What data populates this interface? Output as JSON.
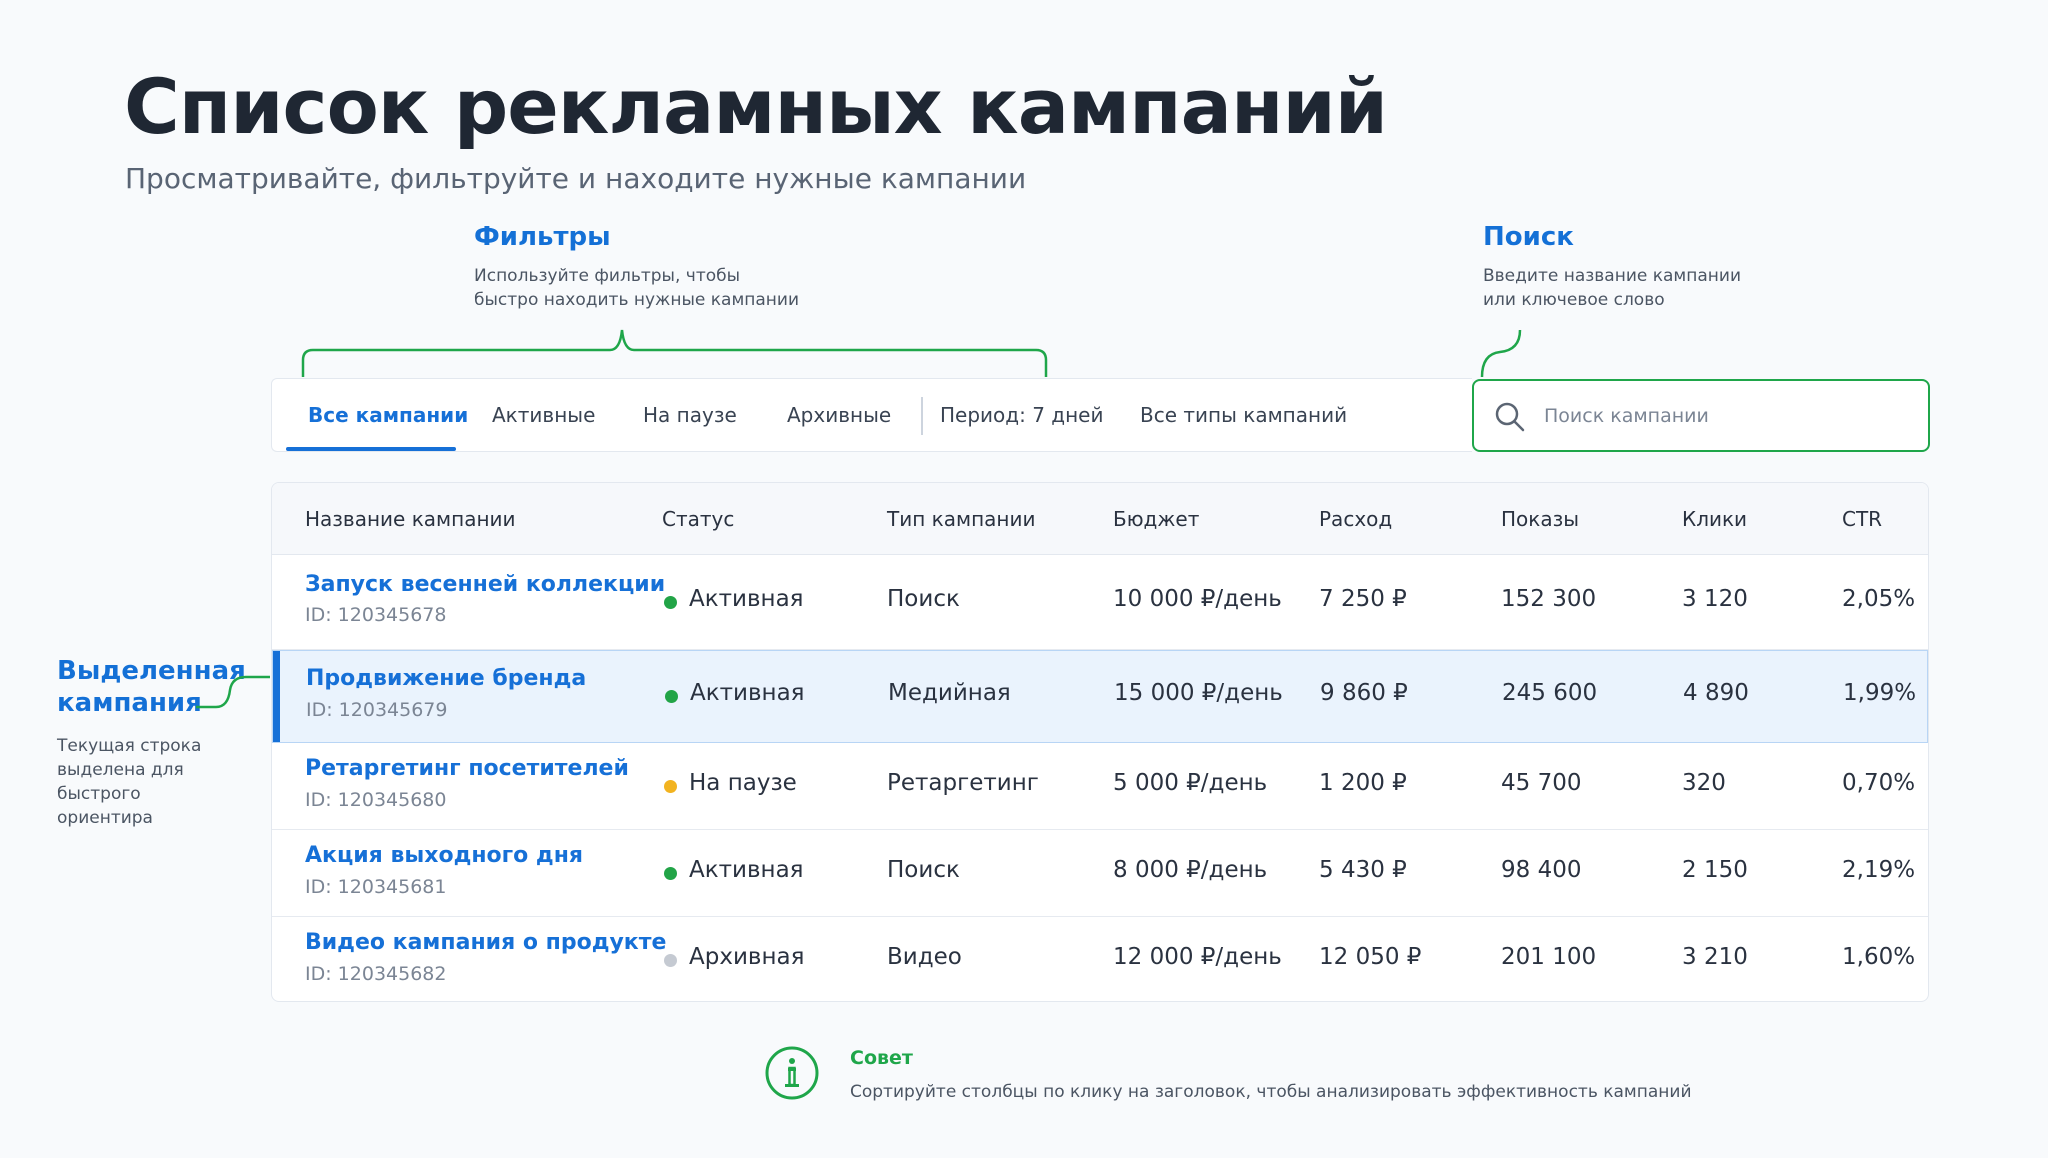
{
  "header": {
    "title": "Список рекламных кампаний",
    "subtitle": "Просматривайте, фильтруйте и находите нужные кампании"
  },
  "annotations": {
    "filters": {
      "title": "Фильтры",
      "line1": "Используйте фильтры, чтобы",
      "line2": "быстро находить нужные кампании"
    },
    "search": {
      "title": "Поиск",
      "line1": "Введите название кампании",
      "line2": "или ключевое слово"
    },
    "selected": {
      "title_line1": "Выделенная",
      "title_line2": "кампания",
      "line1": "Текущая строка",
      "line2": "выделена для",
      "line3": "быстрого",
      "line4": "ориентира"
    }
  },
  "toolbar": {
    "tabs": [
      "Все кампании",
      "Активные",
      "На паузе",
      "Архивные"
    ],
    "active_tab": "Все кампании",
    "period": "Период: 7 дней",
    "type_filter": "Все типы кампаний"
  },
  "search": {
    "placeholder": "Поиск кампании",
    "value": ""
  },
  "table": {
    "headers": [
      "Название кампании",
      "Статус",
      "Тип кампании",
      "Бюджет",
      "Расход",
      "Показы",
      "Клики",
      "CTR"
    ],
    "rows": [
      {
        "name": "Запуск весенней коллекции",
        "id": "ID: 120345678",
        "status": "Активная",
        "type": "Поиск",
        "budget": "10 000 ₽/день",
        "spend": "7 250 ₽",
        "impressions": "152 300",
        "clicks": "3 120",
        "ctr": "2,05%"
      },
      {
        "name": "Продвижение бренда",
        "id": "ID: 120345679",
        "status": "Активная",
        "type": "Медийная",
        "budget": "15 000 ₽/день",
        "spend": "9 860 ₽",
        "impressions": "245 600",
        "clicks": "4 890",
        "ctr": "1,99%"
      },
      {
        "name": "Ретаргетинг посетителей",
        "id": "ID: 120345680",
        "status": "На паузе",
        "type": "Ретаргетинг",
        "budget": "5 000 ₽/день",
        "spend": "1 200 ₽",
        "impressions": "45 700",
        "clicks": "320",
        "ctr": "0,70%"
      },
      {
        "name": "Акция выходного дня",
        "id": "ID: 120345681",
        "status": "Активная",
        "type": "Поиск",
        "budget": "8 000 ₽/день",
        "spend": "5 430 ₽",
        "impressions": "98 400",
        "clicks": "2 150",
        "ctr": "2,19%"
      },
      {
        "name": "Видео кампания о продукте",
        "id": "ID: 120345682",
        "status": "Архивная",
        "type": "Видео",
        "budget": "12 000 ₽/день",
        "spend": "12 050 ₽",
        "impressions": "201 100",
        "clicks": "3 210",
        "ctr": "1,60%"
      }
    ],
    "selected_row": "Продвижение бренда"
  },
  "status_colors": {
    "Активная": "#22a447",
    "На паузе": "#f2b320",
    "Архивная": "#c5cad2"
  },
  "tip": {
    "title": "Совет",
    "text": "Сортируйте столбцы по клику на заголовок, чтобы анализировать эффективность кампаний",
    "icon": "info-icon"
  },
  "colors": {
    "accent": "#1670d7",
    "annotation_green": "#1fa64a",
    "selected_row_bg": "#eaf3fd"
  }
}
